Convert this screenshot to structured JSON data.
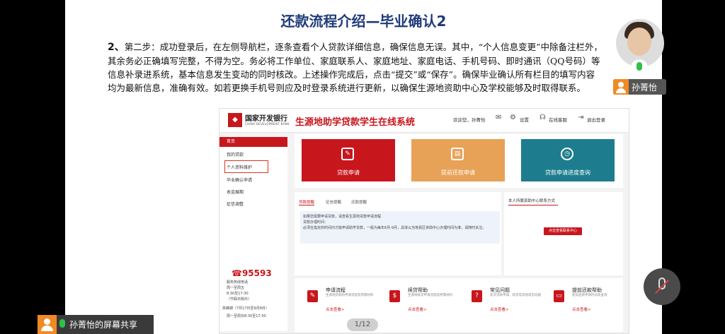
{
  "slide": {
    "title": "还款流程介绍—毕业确认2",
    "para_num": "2、",
    "para_text": "第二步：成功登录后，在左侧导航栏，逐条查看个人贷款详细信息，确保信息无误。其中，“个人信息变更”中除备注栏外，其余务必正确填写完整，不得为空。务必将工作单位、家庭联系人、家庭地址、家庭电话、手机号码、即时通讯（QQ号码）等信息补录进系统，基本信息发生变动的同时核改。上述操作完成后，点击“提交”或“保存”。确保毕业确认所有栏目的填写内容均为最新信息，准确有效。如若更换手机号则应及时登录系统进行更新，以确保生源地资助中心及学校能够及时取得联系。"
  },
  "screenshot": {
    "bank_name": "国家开发银行",
    "bank_en": "CHINA DEVELOPMENT BANK",
    "system_name": "生源地助学贷款学生在线系统",
    "welcome": "欢迎您，孙菁怡",
    "settings": "设置",
    "online_service": "在线客服",
    "logout": "退出登录",
    "sidebar": {
      "home": "首页",
      "items": [
        "我的贷款",
        "个人资料维护",
        "毕业确认申请",
        "本金展期",
        "征信调整"
      ],
      "hotline_phone": "95593",
      "hotline_lines": [
        "服务热线电话",
        "周一至周五",
        "8:30至17:30",
        "（节假日除外）",
        "高峰期（7月17日至9月8日）",
        "周一至周日8:30至17:30"
      ]
    },
    "cards": [
      {
        "label": "贷款申请",
        "icon": "edit-doc-icon",
        "color": "#c8161d"
      },
      {
        "label": "提前还款申请",
        "icon": "form-icon",
        "color": "#e8a257"
      },
      {
        "label": "贷款申请进度查询",
        "icon": "clock-icon",
        "color": "#1d7d8e"
      }
    ],
    "tabs": [
      "贷款提醒",
      "征信提醒",
      "还款提醒"
    ],
    "notice_lines": [
      "如果您需要申请贷款，请查看生源地贷款申请流程",
      "贷款办理时间：",
      "必须在指定的时间内才能申请助学贷款，一般为每年6月-9月，具体以当地县区资助中心办理时间为准，请随时关注。"
    ],
    "contact_title": "本人所属资助中心联系方式",
    "contact_button": "点击查看联系中心",
    "bottom_items": [
      {
        "title": "申请流程",
        "desc": "生源地贷款的申请流程及所需材料",
        "more": "点击查看>",
        "icon": "edit-icon"
      },
      {
        "title": "续贷帮助",
        "desc": "生源地续贷申请流程及所需材料",
        "more": "点击查看>",
        "icon": "coins-icon"
      },
      {
        "title": "常见问题",
        "desc": "初次贷款申请、续贷等其他常见问题",
        "more": "点击查看>",
        "icon": "question-icon"
      },
      {
        "title": "提前还款帮助",
        "desc": "提前还款申请时间及查询",
        "more": "点击查看>",
        "icon": "card-icon"
      }
    ]
  },
  "meeting": {
    "screen_share_text": "孙菁怡的屏幕共享",
    "participant_name": "孙菁怡",
    "page_indicator": "1/12"
  }
}
